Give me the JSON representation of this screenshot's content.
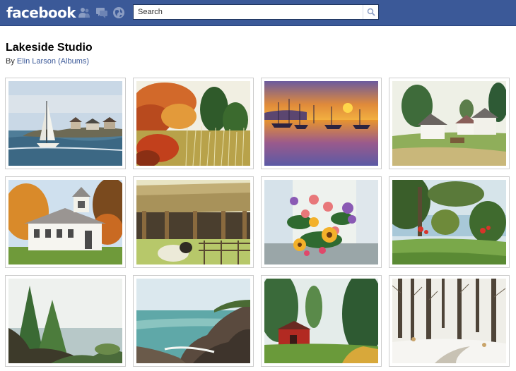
{
  "header": {
    "logo_text": "facebook",
    "brand_color": "#3b5998",
    "search": {
      "placeholder": "Search",
      "value": ""
    },
    "icons": [
      "friend-requests-icon",
      "messages-icon",
      "notifications-icon",
      "search-icon"
    ]
  },
  "album": {
    "title": "Lakeside Studio",
    "by_label": "By",
    "author": "Elin Larson",
    "albums_link": "(Albums)"
  },
  "photos": [
    {
      "subject": "sailboat-near-rocky-island"
    },
    {
      "subject": "autumn-trees-and-tall-grass"
    },
    {
      "subject": "harbor-sunset-with-boats"
    },
    {
      "subject": "farmhouses-on-green-hill"
    },
    {
      "subject": "white-church-in-autumn"
    },
    {
      "subject": "barn-shelter-with-sheep"
    },
    {
      "subject": "flower-bouquet-by-window"
    },
    {
      "subject": "lake-view-through-trees"
    },
    {
      "subject": "pine-trees-on-shore"
    },
    {
      "subject": "rocky-coastline-and-sea"
    },
    {
      "subject": "red-barn-among-pines"
    },
    {
      "subject": "winter-forest-path"
    }
  ]
}
